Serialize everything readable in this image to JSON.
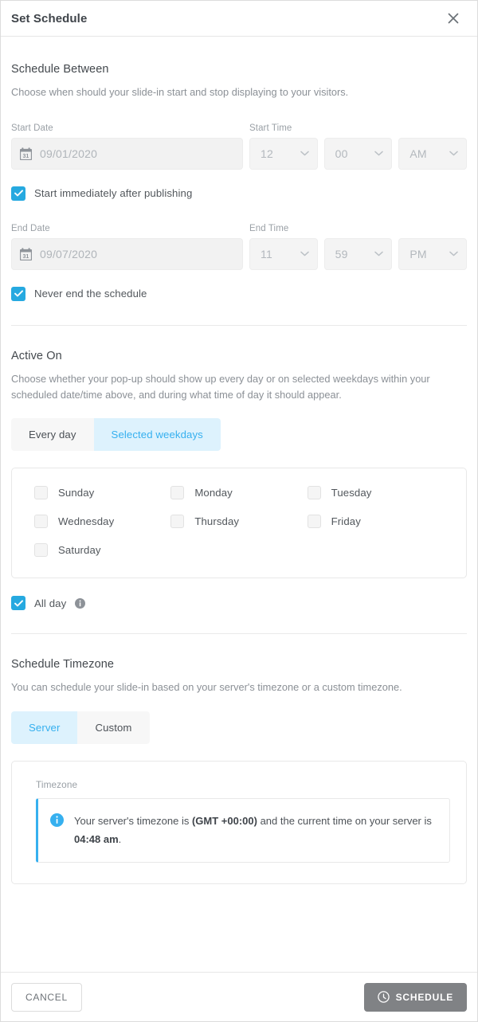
{
  "header": {
    "title": "Set Schedule",
    "close_icon": "close-icon"
  },
  "schedule_between": {
    "title": "Schedule Between",
    "description": "Choose when should your slide-in start and stop displaying to your visitors.",
    "start_date_label": "Start Date",
    "start_date_value": "09/01/2020",
    "start_time_label": "Start Time",
    "start_hour": "12",
    "start_minute": "00",
    "start_meridiem": "AM",
    "start_immediately_label": "Start immediately after publishing",
    "start_immediately_checked": true,
    "end_date_label": "End Date",
    "end_date_value": "09/07/2020",
    "end_time_label": "End Time",
    "end_hour": "11",
    "end_minute": "59",
    "end_meridiem": "PM",
    "never_end_label": "Never end the schedule",
    "never_end_checked": true,
    "calendar_icon": "calendar-icon",
    "chevron_icon": "chevron-down-icon"
  },
  "active_on": {
    "title": "Active On",
    "description": "Choose whether your pop-up should show up every day or on selected weekdays within your scheduled date/time above, and during what time of day it should appear.",
    "tabs": [
      {
        "label": "Every day",
        "active": false
      },
      {
        "label": "Selected weekdays",
        "active": true
      }
    ],
    "weekdays": [
      {
        "label": "Sunday",
        "checked": false
      },
      {
        "label": "Monday",
        "checked": false
      },
      {
        "label": "Tuesday",
        "checked": false
      },
      {
        "label": "Wednesday",
        "checked": false
      },
      {
        "label": "Thursday",
        "checked": false
      },
      {
        "label": "Friday",
        "checked": false
      },
      {
        "label": "Saturday",
        "checked": false
      }
    ],
    "all_day_label": "All day",
    "all_day_checked": true,
    "all_day_info_icon": "info-icon"
  },
  "timezone": {
    "title": "Schedule Timezone",
    "description": "You can schedule your slide-in based on your server's timezone or a custom timezone.",
    "tabs": [
      {
        "label": "Server",
        "active": true
      },
      {
        "label": "Custom",
        "active": false
      }
    ],
    "field_label": "Timezone",
    "notice_icon": "info-circle-icon",
    "notice_part1": "Your server's timezone is ",
    "notice_gmt": "(GMT +00:00)",
    "notice_part2": " and the current time on your server is ",
    "notice_time": "04:48 am",
    "notice_part3": "."
  },
  "footer": {
    "cancel_label": "CANCEL",
    "schedule_label": "SCHEDULE",
    "schedule_icon": "clock-icon"
  },
  "colors": {
    "accent": "#26a9e0",
    "tab_active_bg": "#ddf2fd",
    "tab_active_text": "#36b0ef",
    "schedule_button_bg": "#808285"
  }
}
